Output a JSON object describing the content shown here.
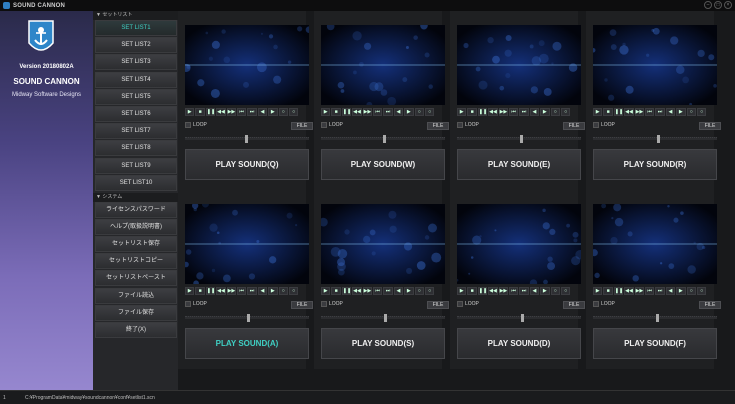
{
  "window": {
    "title": "SOUND CANNON"
  },
  "brand": {
    "version": "Version 20180802A",
    "name": "SOUND CANNON",
    "company": "Midway Software Designs"
  },
  "menu": {
    "setlist_header": "セットリスト",
    "setlists": [
      "SET LIST1",
      "SET LIST2",
      "SET LIST3",
      "SET LIST4",
      "SET LIST5",
      "SET LIST6",
      "SET LIST7",
      "SET LIST8",
      "SET LIST9",
      "SET LIST10"
    ],
    "active_setlist": "SET LIST1",
    "system_header": "システム",
    "system_items": [
      "ライセンスパスワード",
      "ヘルプ(取扱説明書)",
      "セットリスト保存",
      "セットリストコピー",
      "セットリストペースト",
      "ファイル読込",
      "ファイル保存",
      "終了(X)"
    ]
  },
  "players": [
    {
      "play_label": "PLAY SOUND(Q)",
      "loop_label": "LOOP",
      "file_label": "FILE",
      "highlight": false
    },
    {
      "play_label": "PLAY SOUND(W)",
      "loop_label": "LOOP",
      "file_label": "FILE",
      "highlight": false
    },
    {
      "play_label": "PLAY SOUND(E)",
      "loop_label": "LOOP",
      "file_label": "FILE",
      "highlight": false
    },
    {
      "play_label": "PLAY SOUND(R)",
      "loop_label": "LOOP",
      "file_label": "FILE",
      "highlight": false
    },
    {
      "play_label": "PLAY SOUND(A)",
      "loop_label": "LOOP",
      "file_label": "FILE",
      "highlight": true
    },
    {
      "play_label": "PLAY SOUND(S)",
      "loop_label": "LOOP",
      "file_label": "FILE",
      "highlight": false
    },
    {
      "play_label": "PLAY SOUND(D)",
      "loop_label": "LOOP",
      "file_label": "FILE",
      "highlight": false
    },
    {
      "play_label": "PLAY SOUND(F)",
      "loop_label": "LOOP",
      "file_label": "FILE",
      "highlight": false
    }
  ],
  "transport_icons": [
    "play-icon",
    "stop-icon",
    "pause-icon",
    "rewind-icon",
    "forward-icon",
    "prev-icon",
    "next-icon",
    "skip-back-icon",
    "skip-forward-icon",
    "loop-icon",
    "unknown-icon"
  ],
  "transport_glyphs": [
    "▶",
    "■",
    "❚❚",
    "◀◀",
    "▶▶",
    "⏮",
    "⏭",
    "◀",
    "▶",
    "○",
    "○"
  ],
  "statusbar": {
    "number": "1",
    "path": "C:¥ProgramData¥midway¥soundcannon¥conf¥setlist1.scn"
  },
  "colors": {
    "accent": "#3fd0c4",
    "brand_top": "#2a2a4a",
    "brand_bottom": "#9687cf"
  }
}
